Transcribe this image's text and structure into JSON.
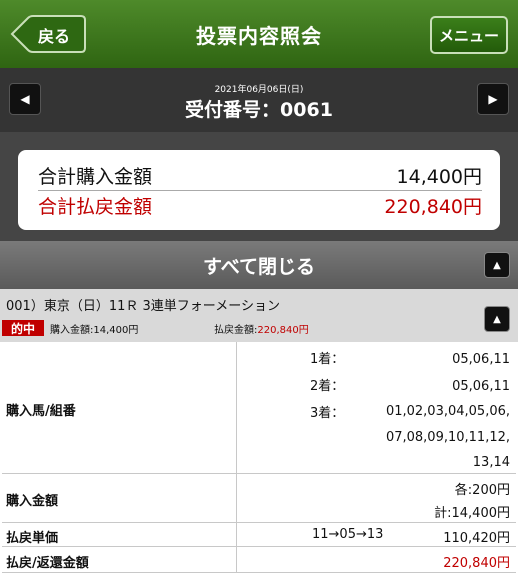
{
  "header": {
    "back_label": "戻る",
    "title": "投票内容照会",
    "menu_label": "メニュー"
  },
  "datebar": {
    "date": "2021年06月06日(日)",
    "receipt": "受付番号：0061"
  },
  "summary": {
    "total_purchase_label": "合計購入金額",
    "total_purchase_value": "14,400円",
    "total_payout_label": "合計払戻金額",
    "total_payout_value": "220,840円"
  },
  "close_all_label": "すべて閉じる",
  "bet": {
    "title": "001）東京（日）11Ｒ 3連単フォーメーション",
    "hit_badge": "的中",
    "purchase_text": "購入金額:14,400円",
    "payout_label": "払戻金額:",
    "payout_value": "220,840円"
  },
  "details": {
    "horses_label": "購入馬/組番",
    "first_label": "1着：",
    "first_value": "05,06,11",
    "second_label": "2着：",
    "second_value": "05,06,11",
    "third_label": "3着：",
    "third_line1": "01,02,03,04,05,06,",
    "third_line2": "07,08,09,10,11,12,",
    "third_line3": "13,14",
    "amount_label": "購入金額",
    "amount_each": "各:200円",
    "amount_total": "計:14,400円",
    "unit_label": "払戻単価",
    "unit_combo": "11→05→13",
    "unit_value": "110,420円",
    "refund_label": "払戻/返還金額",
    "refund_value": "220,840円"
  },
  "colors": {
    "header_green": "#3b7a1c",
    "payout_red": "#c00000"
  }
}
